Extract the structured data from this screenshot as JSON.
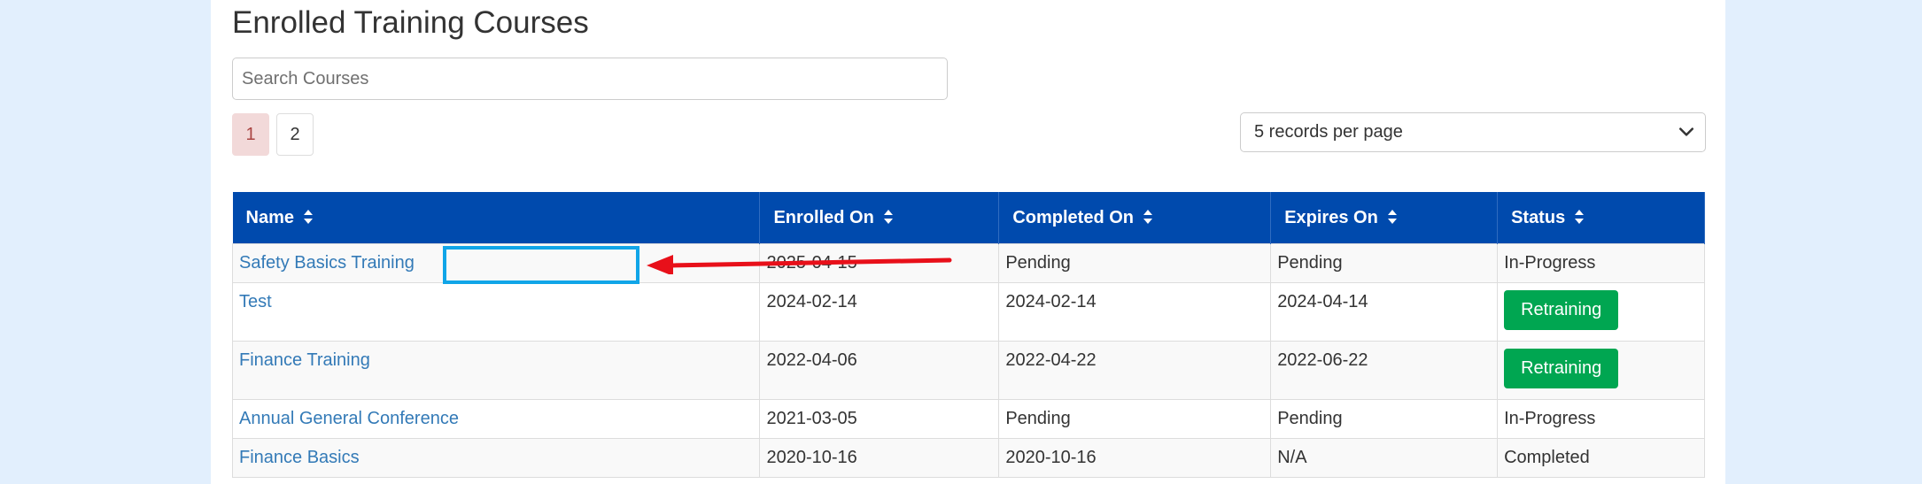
{
  "page": {
    "title": "Enrolled Training Courses"
  },
  "search": {
    "placeholder": "Search Courses"
  },
  "pagination": {
    "pages": [
      "1",
      "2"
    ],
    "active_page": "1"
  },
  "per_page": {
    "selected": "5 records per page"
  },
  "table": {
    "headers": [
      "Name",
      "Enrolled On",
      "Completed On",
      "Expires On",
      "Status"
    ],
    "rows": [
      {
        "name": "Safety Basics Training",
        "enrolled": "2025-04-15",
        "completed": "Pending",
        "expires": "Pending",
        "status": "In-Progress",
        "status_is_button": false
      },
      {
        "name": "Test",
        "enrolled": "2024-02-14",
        "completed": "2024-02-14",
        "expires": "2024-04-14",
        "status": "Retraining",
        "status_is_button": true
      },
      {
        "name": "Finance Training",
        "enrolled": "2022-04-06",
        "completed": "2022-04-22",
        "expires": "2022-06-22",
        "status": "Retraining",
        "status_is_button": true
      },
      {
        "name": "Annual General Conference",
        "enrolled": "2021-03-05",
        "completed": "Pending",
        "expires": "Pending",
        "status": "In-Progress",
        "status_is_button": false
      },
      {
        "name": "Finance Basics",
        "enrolled": "2020-10-16",
        "completed": "2020-10-16",
        "expires": "N/A",
        "status": "Completed",
        "status_is_button": false
      }
    ]
  },
  "icons": {
    "sort": "sort-icon",
    "dropdown": "chevron-down-icon"
  },
  "colors": {
    "header_bg": "#004aad",
    "link": "#337ab7",
    "retrain_button": "#00a651",
    "highlight": "#10a5e8",
    "arrow": "#e8101a",
    "active_page_bg": "#f2d9d9"
  }
}
